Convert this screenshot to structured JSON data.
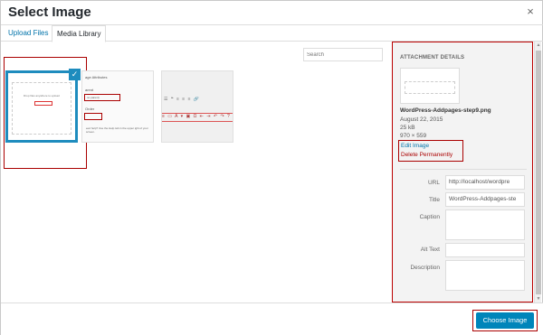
{
  "dialog": {
    "title": "Select Image",
    "close_label": "×"
  },
  "tabs": [
    {
      "label": "Upload Files"
    },
    {
      "label": "Media Library"
    }
  ],
  "search": {
    "placeholder": "Search"
  },
  "thumbnails": {
    "selected_check": "✓",
    "thumb1": {
      "text": "Drop files anywhere to upload"
    },
    "thumb2": {
      "heading": "age Attributes",
      "parent_label": "arent",
      "parent_value": "no parent)",
      "order_label": "Order",
      "help_text": "eed help? Use the Help tab in the upper ight of your screen."
    },
    "thumb3": {
      "toolbar_row1": "☰ ❝ ≡ ≡ ≡ 🔗",
      "toolbar_row2": "≡ ▭ A ▾ ▣ Ω ⇤ ⇥ ↶ ↷ ?"
    }
  },
  "attachment": {
    "section_title": "ATTACHMENT DETAILS",
    "filename": "WordPress-Addpages-step9.png",
    "date": "August 22, 2015",
    "size": "25 kB",
    "dimensions": "970 × 559",
    "edit_link": "Edit Image",
    "delete_link": "Delete Permanently"
  },
  "fields": {
    "url_label": "URL",
    "url_value": "http://localhost/wordpre",
    "title_label": "Title",
    "title_value": "WordPress-Addpages-ste",
    "caption_label": "Caption",
    "alt_label": "Alt Text",
    "description_label": "Description"
  },
  "footer": {
    "choose_label": "Choose Image"
  },
  "colors": {
    "primary": "#0085ba",
    "link": "#0073aa",
    "highlight": "#aa0000"
  }
}
